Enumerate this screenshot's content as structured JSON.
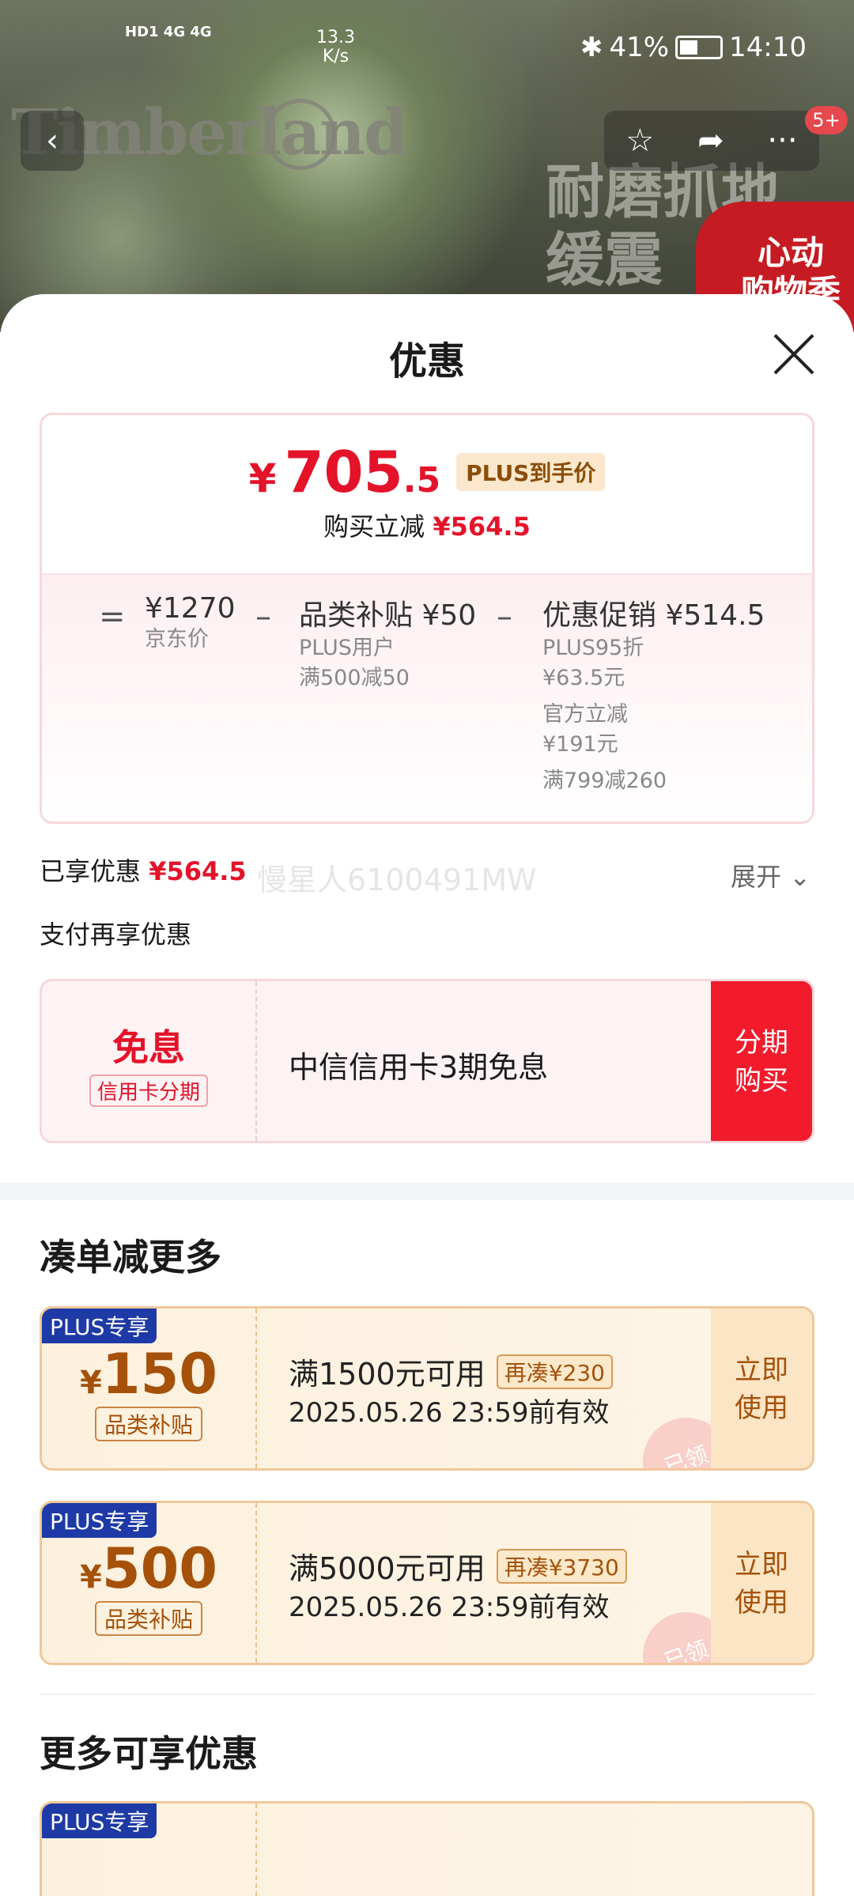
{
  "status_bar": {
    "sim": "HD1 4G 4G",
    "net_speed_value": "13.3",
    "net_speed_unit": "K/s",
    "battery": "41%",
    "time": "14:10"
  },
  "background": {
    "brand": "Timberland",
    "ad_text": "耐磨抓地\n缓震",
    "ad_badge": "心动\n购物季",
    "notification_count": "5+"
  },
  "sheet": {
    "title": "优惠"
  },
  "price_card": {
    "final_currency": "¥",
    "final_int": "705",
    "final_dec": ".5",
    "plus_label": "PLUS到手价",
    "reduce_label": "购买立减",
    "reduce_value": "¥564.5",
    "eq": "=",
    "jd_price": "¥1270",
    "jd_label": "京东价",
    "minus1": "–",
    "subsidy_title": "品类补贴",
    "subsidy_value": "¥50",
    "subsidy_line1": "PLUS用户",
    "subsidy_line2": "满500减50",
    "minus2": "–",
    "promo_title": "优惠促销",
    "promo_value": "¥514.5",
    "promo_line1": "PLUS95折",
    "promo_line2": "¥63.5元",
    "promo_line3": "官方立减",
    "promo_line4": "¥191元",
    "promo_line5": "满799减260"
  },
  "enjoyed": {
    "label": "已享优惠",
    "value": "¥564.5",
    "watermark": "慢星人6100491MW",
    "expand": "展开"
  },
  "payment": {
    "section_label": "支付再享优惠",
    "free_label": "免息",
    "free_sub": "信用卡分期",
    "desc": "中信信用卡3期免息",
    "button": "分期\n购买"
  },
  "bundle": {
    "title": "凑单减更多",
    "coupons": [
      {
        "tag": "PLUS专享",
        "currency": "¥",
        "amount": "150",
        "category": "品类补贴",
        "condition": "满1500元可用",
        "add_more": "再凑¥230",
        "validity": "2025.05.26 23:59前有效",
        "button": "立即\n使用",
        "stamp": "已领"
      },
      {
        "tag": "PLUS专享",
        "currency": "¥",
        "amount": "500",
        "category": "品类补贴",
        "condition": "满5000元可用",
        "add_more": "再凑¥3730",
        "validity": "2025.05.26 23:59前有效",
        "button": "立即\n使用",
        "stamp": "已领"
      }
    ]
  },
  "more": {
    "title": "更多可享优惠",
    "partial_tag": "PLUS专享"
  },
  "colors": {
    "accent_red": "#e4132a",
    "plus_blue": "#1d3aa6",
    "coupon_brown": "#a5510a"
  }
}
